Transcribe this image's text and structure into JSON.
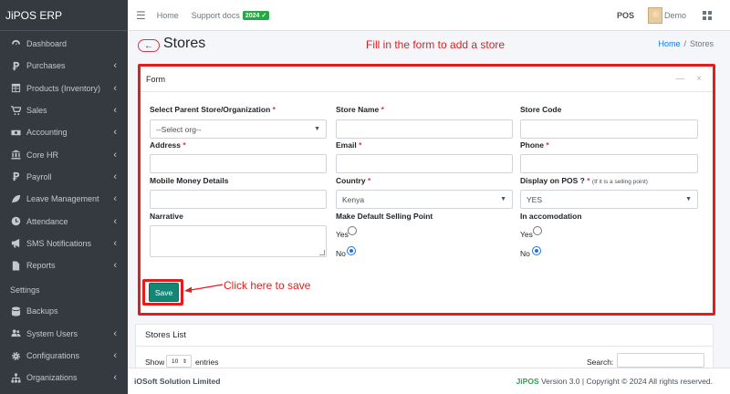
{
  "app": {
    "brand": "JiPOS ERP"
  },
  "sidebar": {
    "items": [
      {
        "label": "Dashboard",
        "icon": "dashboard-icon",
        "has_children": false
      },
      {
        "label": "Purchases",
        "icon": "currency-icon",
        "has_children": true
      },
      {
        "label": "Products (Inventory)",
        "icon": "table-icon",
        "has_children": true
      },
      {
        "label": "Sales",
        "icon": "cart-icon",
        "has_children": true
      },
      {
        "label": "Accounting",
        "icon": "money-icon",
        "has_children": true
      },
      {
        "label": "Core HR",
        "icon": "building-icon",
        "has_children": true
      },
      {
        "label": "Payroll",
        "icon": "currency-icon",
        "has_children": true
      },
      {
        "label": "Leave Management",
        "icon": "leaf-icon",
        "has_children": true
      },
      {
        "label": "Attendance",
        "icon": "clock-icon",
        "has_children": true
      },
      {
        "label": "SMS Notifications",
        "icon": "bullhorn-icon",
        "has_children": true
      },
      {
        "label": "Reports",
        "icon": "file-icon",
        "has_children": true
      }
    ],
    "settings_header": "Settings",
    "settings_items": [
      {
        "label": "Backups",
        "icon": "database-icon",
        "has_children": false
      },
      {
        "label": "System Users",
        "icon": "users-icon",
        "has_children": true
      },
      {
        "label": "Configurations",
        "icon": "gear-icon",
        "has_children": true
      },
      {
        "label": "Organizations",
        "icon": "sitemap-icon",
        "has_children": true
      }
    ]
  },
  "topbar": {
    "home": "Home",
    "support": "Support docs",
    "badge": "2024",
    "pos": "POS",
    "user": "Demo"
  },
  "page": {
    "title": "Stores",
    "annotation": "Fill in the form to add a store",
    "breadcrumb_home": "Home",
    "breadcrumb_sep": "/",
    "breadcrumb_current": "Stores"
  },
  "form": {
    "card_title": "Form",
    "tool_minimize": "—",
    "tool_close": "×",
    "required_mark": "*",
    "parent_label": "Select Parent Store/Organization",
    "parent_value": "--Select org--",
    "store_name_label": "Store Name",
    "store_code_label": "Store Code",
    "address_label": "Address",
    "email_label": "Email",
    "phone_label": "Phone",
    "mobile_money_label": "Mobile Money Details",
    "country_label": "Country",
    "country_value": "Kenya",
    "display_pos_label": "Display on POS ?",
    "display_pos_hint": "(If it is a selling point)",
    "display_pos_value": "YES",
    "narrative_label": "Narrative",
    "default_selling_label": "Make Default Selling Point",
    "default_selling_yes": "Yes",
    "default_selling_no": "No",
    "default_selling_selected": "No",
    "accomodation_label": "In accomodation",
    "accomodation_yes": "Yes",
    "accomodation_no": "No",
    "accomodation_selected": "No",
    "save_label": "Save",
    "save_annotation": "Click here to save"
  },
  "stores_list": {
    "title": "Stores List",
    "show": "Show",
    "entries_value": "10",
    "entries": "entries",
    "search": "Search:"
  },
  "footer": {
    "company": "iOSoft Solution Limited",
    "product": "JiPOS",
    "rest": " Version 3.0 | Copyright © 2024 All rights reserved."
  },
  "colors": {
    "sidebar_bg": "#343a40",
    "accent_red": "#e21d1d",
    "save_button": "#138676",
    "badge_green": "#28a745",
    "link_blue": "#007bff"
  }
}
